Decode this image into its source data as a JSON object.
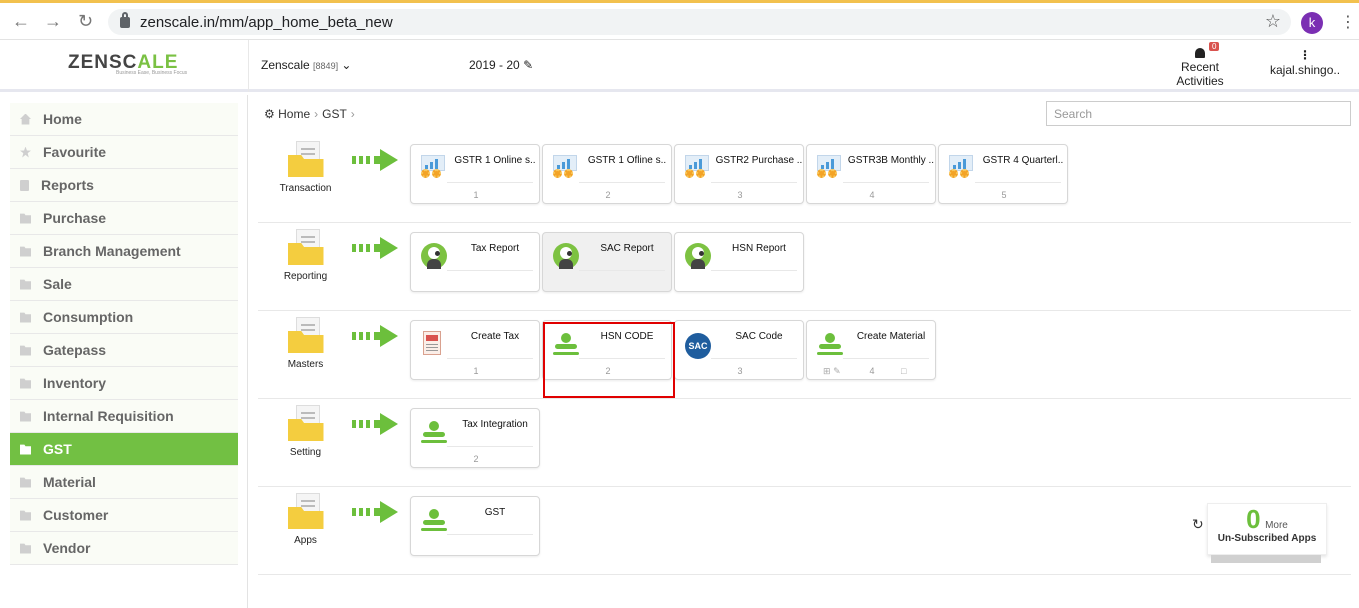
{
  "browser": {
    "url": "zenscale.in/mm/app_home_beta_new",
    "profile_initial": "k"
  },
  "header": {
    "logo_main": "ZENSC",
    "logo_accent": "ALE",
    "logo_tagline": "Business Ease, Business Focus",
    "company": "Zenscale",
    "company_code": "[8849]",
    "year": "2019 - 20",
    "recent_label": "Recent Activities",
    "recent_badge": "0",
    "user": "kajal.shingo.."
  },
  "sidebar": {
    "items": [
      {
        "label": "Home",
        "icon": "home-icon"
      },
      {
        "label": "Favourite",
        "icon": "star-icon"
      },
      {
        "label": "Reports",
        "icon": "document-icon"
      },
      {
        "label": "Purchase",
        "icon": "folder-icon"
      },
      {
        "label": "Branch Management",
        "icon": "folder-icon"
      },
      {
        "label": "Sale",
        "icon": "folder-icon"
      },
      {
        "label": "Consumption",
        "icon": "folder-icon"
      },
      {
        "label": "Gatepass",
        "icon": "folder-icon"
      },
      {
        "label": "Inventory",
        "icon": "folder-icon"
      },
      {
        "label": "Internal Requisition",
        "icon": "folder-icon"
      },
      {
        "label": "GST",
        "icon": "folder-icon"
      },
      {
        "label": "Material",
        "icon": "folder-icon"
      },
      {
        "label": "Customer",
        "icon": "folder-icon"
      },
      {
        "label": "Vendor",
        "icon": "folder-icon"
      }
    ],
    "active": "GST"
  },
  "breadcrumb": {
    "home": "Home",
    "current": "GST"
  },
  "search": {
    "placeholder": "Search"
  },
  "groups": [
    {
      "name": "Transaction",
      "tiles": [
        {
          "label": "GSTR 1 Online s..",
          "num": "1"
        },
        {
          "label": "GSTR 1 Ofline s..",
          "num": "2"
        },
        {
          "label": "GSTR2 Purchase ..",
          "num": "3"
        },
        {
          "label": "GSTR3B Monthly ..",
          "num": "4"
        },
        {
          "label": "GSTR 4 Quarterl..",
          "num": "5"
        }
      ]
    },
    {
      "name": "Reporting",
      "tiles": [
        {
          "label": "Tax Report",
          "num": ""
        },
        {
          "label": "SAC Report",
          "num": ""
        },
        {
          "label": "HSN Report",
          "num": ""
        }
      ]
    },
    {
      "name": "Masters",
      "tiles": [
        {
          "label": "Create Tax",
          "num": "1"
        },
        {
          "label": "HSN CODE",
          "num": "2"
        },
        {
          "label": "SAC Code",
          "num": "3"
        },
        {
          "label": "Create Material",
          "num": "4"
        }
      ]
    },
    {
      "name": "Setting",
      "tiles": [
        {
          "label": "Tax Integration",
          "num": "2"
        }
      ]
    },
    {
      "name": "Apps",
      "tiles": [
        {
          "label": "GST",
          "num": ""
        }
      ]
    }
  ],
  "sac_icon_text": "SAC",
  "unsubscribed": {
    "count": "0",
    "more": "More",
    "label": "Un-Subscribed Apps"
  },
  "colors": {
    "accent_green": "#72c043",
    "highlight_red": "#e00000"
  }
}
